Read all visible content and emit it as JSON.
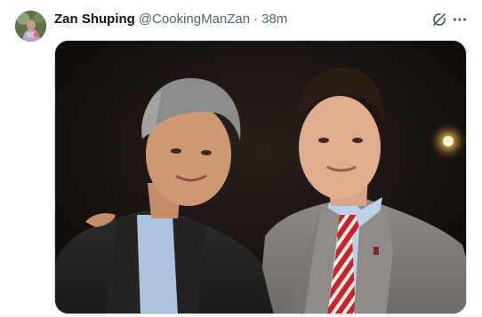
{
  "tweet": {
    "author": {
      "display_name": "Zan Shuping",
      "handle": "@CookingManZan",
      "avatar_icon": "user-avatar"
    },
    "separator": "·",
    "timestamp": "38m",
    "actions": {
      "grok_icon": "grok-icon",
      "more_icon": "more-options-icon"
    },
    "media": {
      "type": "photo"
    }
  },
  "colors": {
    "text_primary": "#0f1419",
    "text_secondary": "#536471",
    "border": "#cfd9de",
    "photo_background": "#130f0d"
  }
}
